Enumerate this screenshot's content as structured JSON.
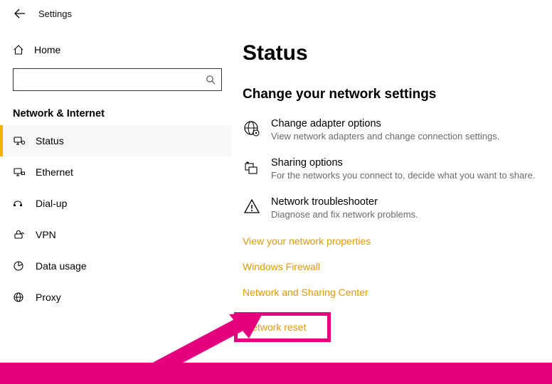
{
  "window": {
    "title": "Settings"
  },
  "sidebar": {
    "home_label": "Home",
    "search_placeholder": "",
    "section_label": "Network & Internet",
    "items": [
      {
        "label": "Status"
      },
      {
        "label": "Ethernet"
      },
      {
        "label": "Dial-up"
      },
      {
        "label": "VPN"
      },
      {
        "label": "Data usage"
      },
      {
        "label": "Proxy"
      }
    ]
  },
  "main": {
    "heading": "Status",
    "subheading": "Change your network settings",
    "opts": [
      {
        "title": "Change adapter options",
        "desc": "View network adapters and change connection settings."
      },
      {
        "title": "Sharing options",
        "desc": "For the networks you connect to, decide what you want to share."
      },
      {
        "title": "Network troubleshooter",
        "desc": "Diagnose and fix network problems."
      }
    ],
    "links": {
      "view_props": "View your network properties",
      "firewall": "Windows Firewall",
      "sharing_center": "Network and Sharing Center",
      "reset": "Network reset"
    }
  }
}
